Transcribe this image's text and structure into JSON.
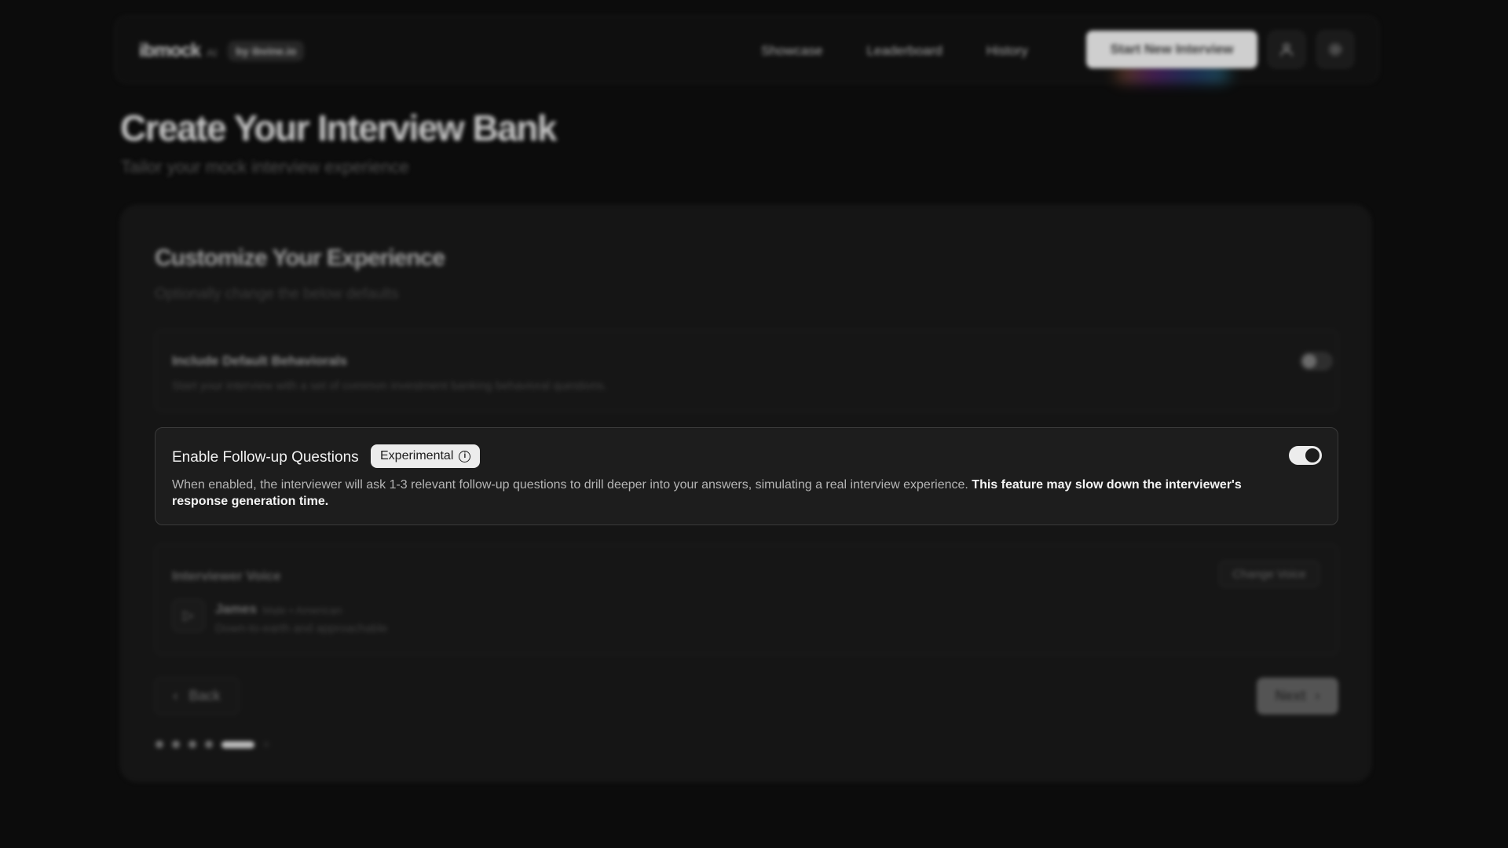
{
  "header": {
    "logo_name": "ibmock",
    "logo_suffix": "AI",
    "logo_by": "by ibvine.io",
    "nav": [
      "Showcase",
      "Leaderboard",
      "History"
    ],
    "cta_label": "Start New Interview",
    "profile_icon": "user-icon",
    "settings_icon": "gear-icon"
  },
  "page": {
    "title": "Create Your Interview Bank",
    "subtitle": "Tailor your mock interview experience"
  },
  "card": {
    "title": "Customize Your Experience",
    "subtitle": "Optionally change the below defaults",
    "options": [
      {
        "title": "Include Default Behaviorals",
        "description": "Start your interview with a set of common investment banking behavioral questions.",
        "enabled": false
      },
      {
        "title": "Enable Follow-up Questions",
        "badge": "Experimental",
        "description": "When enabled, the interviewer will ask 1-3 relevant follow-up questions to drill deeper into your answers, simulating a real interview experience.",
        "description_emphasis": "This feature may slow down the interviewer's response generation time.",
        "enabled": true
      }
    ],
    "voice": {
      "title": "Interviewer Voice",
      "change_label": "Change Voice",
      "name": "James",
      "meta": "Male • American",
      "description": "Down-to-earth and approachable"
    },
    "back_label": "Back",
    "next_label": "Next",
    "steps_total": 6,
    "step_current": 5
  },
  "colors": {
    "background": "#0c0c0c",
    "card": "#151515",
    "accent": "#ececec"
  }
}
